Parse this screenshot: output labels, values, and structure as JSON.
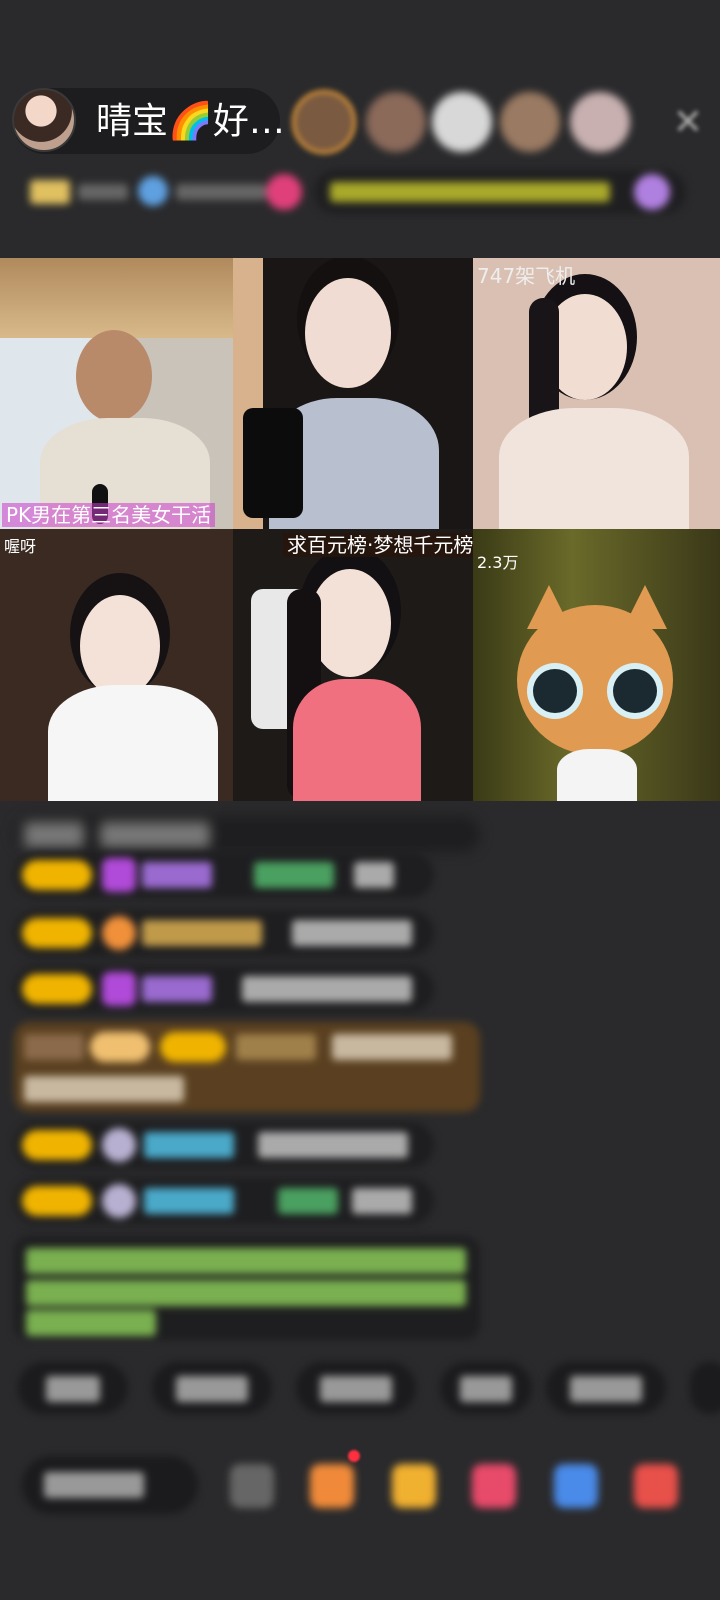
{
  "header": {
    "host_name": "晴宝🌈好…",
    "close_label": "✕"
  },
  "tiles": [
    {
      "label": "PK男在第三名美女干活"
    },
    {
      "label": ""
    },
    {
      "label": "747架飞机"
    },
    {
      "label": "喔呀"
    },
    {
      "label": "求百元榜·梦想千元榜"
    },
    {
      "label": "2.3万"
    }
  ]
}
